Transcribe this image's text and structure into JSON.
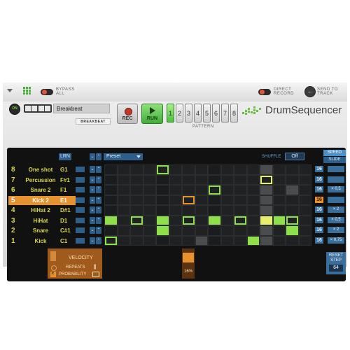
{
  "rack": {
    "bypass_label": "BYPASS\nALL",
    "direct_record_label": "DIRECT\nRECORD",
    "send_to_track_label": "SEND TO\nTRACK"
  },
  "header": {
    "on_label": "ON",
    "preset_name": "Breakbeat",
    "tape_label": "BREAKBEAT",
    "rec_label": "REC",
    "run_label": "RUN",
    "pattern_label": "PATTERN",
    "pattern_numbers": [
      "1",
      "2",
      "3",
      "4",
      "5",
      "6",
      "7",
      "8"
    ],
    "brand_label": "DrumSequencer"
  },
  "grid_header": {
    "lrn_label": "LRN",
    "preset_select": "Preset",
    "shuffle_label": "SHUFFLE",
    "shuffle_value": "Off",
    "speed_label": "SPEED",
    "slide_label": "SLIDE"
  },
  "lanes": [
    {
      "number": "8",
      "name": "One shot",
      "note": "G1",
      "steps": [
        0,
        0,
        0,
        0,
        0,
        0,
        0,
        0,
        0,
        0,
        0,
        0,
        0,
        0,
        0,
        0
      ],
      "value": "16",
      "extra": ""
    },
    {
      "number": "7",
      "name": "Percussion",
      "note": "F#1",
      "steps": [
        0,
        0,
        0,
        0,
        0,
        0,
        0,
        0,
        0,
        0,
        0,
        0,
        0,
        0,
        0,
        0
      ],
      "value": "16",
      "extra": ""
    },
    {
      "number": "6",
      "name": "Snare 2",
      "note": "F1",
      "steps": [
        0,
        0,
        0,
        0,
        0,
        0,
        0,
        0,
        0,
        0,
        0,
        0,
        0,
        0,
        0,
        0
      ],
      "value": "16",
      "extra": "× 0,5"
    },
    {
      "number": "5",
      "name": "Kick 2",
      "note": "E1",
      "steps": [
        0,
        0,
        0,
        0,
        0,
        0,
        0,
        0,
        0,
        0,
        0,
        0,
        0,
        0,
        0,
        0
      ],
      "value": "16",
      "extra": ""
    },
    {
      "number": "4",
      "name": "HiHat 2",
      "note": "D#1",
      "steps": [
        0,
        0,
        0,
        0,
        0,
        0,
        0,
        0,
        0,
        0,
        0,
        0,
        0,
        0,
        0,
        0
      ],
      "value": "16",
      "extra": "× 2"
    },
    {
      "number": "3",
      "name": "HiHat",
      "note": "D1",
      "steps": [
        0,
        0,
        0,
        0,
        0,
        0,
        0,
        0,
        0,
        0,
        0,
        0,
        0,
        0,
        0,
        0
      ],
      "value": "16",
      "extra": "× 0,5"
    },
    {
      "number": "2",
      "name": "Snare",
      "note": "C#1",
      "steps": [
        0,
        0,
        0,
        0,
        0,
        0,
        0,
        0,
        0,
        0,
        0,
        0,
        0,
        0,
        0,
        0
      ],
      "value": "16",
      "extra": "× 2"
    },
    {
      "number": "1",
      "name": "Kick",
      "note": "C1",
      "steps": [
        0,
        0,
        0,
        0,
        0,
        0,
        0,
        0,
        0,
        0,
        0,
        0,
        0,
        0,
        0,
        0
      ],
      "value": "16",
      "extra": "× 0,75"
    }
  ],
  "selected_lane": "5",
  "bottom": {
    "velocity_label": "VELOCITY",
    "repeats_label": "REPEATS",
    "probability_label": "PROBABILITY",
    "probability_value": "16%",
    "reset_label": "RESET\nSTEP",
    "reset_value": "64"
  },
  "colors": {
    "screen_bg": "#111111",
    "step_green": "#8ee04a",
    "step_yellow": "#e8ef6a",
    "step_orange": "#e6922e",
    "label_yellow": "#d8d84a",
    "accent_blue": "#3b6f9b"
  }
}
